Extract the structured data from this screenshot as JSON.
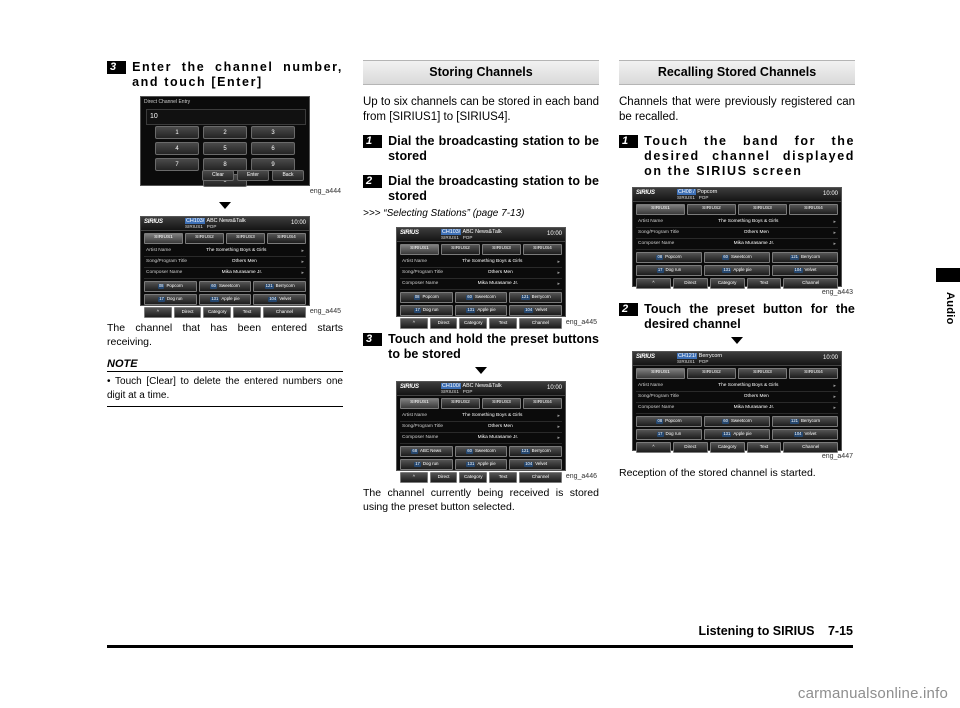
{
  "footer": {
    "title": "Listening to SIRIUS",
    "page": "7-15"
  },
  "sidetab": {
    "label": "Audio"
  },
  "watermark": "carmanualsonline.info",
  "col1": {
    "step3": {
      "num": "3",
      "text": "Enter the channel number, and touch [Enter]"
    },
    "caption1": "eng_a444",
    "caption2": "eng_a445",
    "body": "The channel that has been entered starts receiving.",
    "note_title": "NOTE",
    "note_item": "• Touch [Clear] to delete the entered numbers one digit at a time."
  },
  "col2": {
    "section_title": "Storing Channels",
    "intro": "Up to six channels can be stored in each band from [SIRIUS1] to [SIRIUS4].",
    "step1": {
      "num": "1",
      "text": "Dial the broadcasting station to be stored"
    },
    "step2": {
      "num": "2",
      "text": "Dial the broadcasting station to be stored"
    },
    "xref": ">>> “Selecting Stations” (page 7-13)",
    "caption1": "eng_a445",
    "step3": {
      "num": "3",
      "text": "Touch and hold the preset buttons to be stored"
    },
    "caption2": "eng_a446",
    "body": "The channel currently being received is stored using the preset button selected."
  },
  "col3": {
    "section_title": "Recalling Stored Channels",
    "intro": "Channels that were previously registered can be recalled.",
    "step1": {
      "num": "1",
      "text": "Touch the band for the desired channel displayed on the SIRIUS screen"
    },
    "caption1": "eng_a443",
    "step2": {
      "num": "2",
      "text": "Touch the preset button for the desired channel"
    },
    "caption2": "eng_a447",
    "body": "Reception of the stored channel is started."
  },
  "dialpad": {
    "title": "Direct Channel Entry",
    "value": "10",
    "keys": [
      [
        "1",
        "2",
        "3"
      ],
      [
        "4",
        "5",
        "6"
      ],
      [
        "7",
        "8",
        "9"
      ],
      [
        "",
        "0",
        ""
      ]
    ],
    "center_key": "0",
    "buttons": [
      "Clear",
      "Enter",
      "Back"
    ],
    "back_icon": "back-arrow-icon"
  },
  "sirius_a445": {
    "logo": "SIRIUS",
    "channel": "CH103/",
    "station": "ABC News&Talk",
    "band": "SIRIUS1",
    "category": "POP",
    "clock": "10:00",
    "presets": [
      "SIRIUS1",
      "SIRIUS2",
      "SIRIUS3",
      "SIRIUS4"
    ],
    "rows": [
      {
        "label": "Artist Name",
        "value": "The Something Boys & Girls"
      },
      {
        "label": "Song/Program Title",
        "value": "Others Men"
      },
      {
        "label": "Composer Name",
        "value": "Mika Murasame Jr."
      }
    ],
    "mid": [
      {
        "num": "08",
        "label": "Popcorn"
      },
      {
        "num": "60",
        "label": "Sweetcorn"
      },
      {
        "num": "121",
        "label": "Berrycorn"
      }
    ],
    "mid2": [
      {
        "num": "17",
        "label": "Dog run"
      },
      {
        "num": "131",
        "label": "Apple pie"
      },
      {
        "num": "104",
        "label": "Velvet"
      }
    ],
    "bottom": [
      "^",
      "Direct",
      "Category",
      "Text",
      "Channel"
    ],
    "channel_left_icon": "left-arrow-icon",
    "channel_right_icon": "right-arrow-icon"
  },
  "sirius_a446": {
    "logo": "SIRIUS",
    "channel": "CH100/",
    "station": "ABC News&Talk",
    "band": "SIRIUS1",
    "category": "POP",
    "clock": "10:00",
    "presets": [
      "SIRIUS1",
      "SIRIUS2",
      "SIRIUS3",
      "SIRIUS4"
    ],
    "rows": [
      {
        "label": "Artist Name",
        "value": "The Something Boys & Girls"
      },
      {
        "label": "Song/Program Title",
        "value": "Others Men"
      },
      {
        "label": "Composer Name",
        "value": "Mika Murasame Jr."
      }
    ],
    "mid": [
      {
        "num": "68",
        "label": "ABC News"
      },
      {
        "num": "60",
        "label": "Sweetcorn"
      },
      {
        "num": "121",
        "label": "Berrycorn"
      }
    ],
    "mid2": [
      {
        "num": "17",
        "label": "Dog run"
      },
      {
        "num": "131",
        "label": "Apple pie"
      },
      {
        "num": "104",
        "label": "Velvet"
      }
    ],
    "bottom": [
      "^",
      "Direct",
      "Category",
      "Text",
      "Channel"
    ]
  },
  "sirius_a443": {
    "logo": "SIRIUS",
    "channel": "CH08 /",
    "station": "Popcorn",
    "band": "SIRIUS1",
    "category": "POP",
    "clock": "10:00",
    "presets": [
      "SIRIUS1",
      "SIRIUS2",
      "SIRIUS3",
      "SIRIUS4"
    ],
    "rows": [
      {
        "label": "Artist Name",
        "value": "The Something Boys & Girls"
      },
      {
        "label": "Song/Program Title",
        "value": "Others Men"
      },
      {
        "label": "Composer Name",
        "value": "Mika Murasame Jr."
      }
    ],
    "mid": [
      {
        "num": "08",
        "label": "Popcorn"
      },
      {
        "num": "60",
        "label": "Sweetcorn"
      },
      {
        "num": "121",
        "label": "Berrycorn"
      }
    ],
    "mid2": [
      {
        "num": "17",
        "label": "Dog run"
      },
      {
        "num": "131",
        "label": "Apple pie"
      },
      {
        "num": "104",
        "label": "Velvet"
      }
    ],
    "bottom": [
      "^",
      "Direct",
      "Category",
      "Text",
      "Channel"
    ]
  },
  "sirius_a447": {
    "logo": "SIRIUS",
    "channel": "CH121/",
    "station": "Berrycorn",
    "band": "SIRIUS1",
    "category": "POP",
    "clock": "10:00",
    "presets": [
      "SIRIUS1",
      "SIRIUS2",
      "SIRIUS3",
      "SIRIUS4"
    ],
    "rows": [
      {
        "label": "Artist Name",
        "value": "The Something Boys & Girls"
      },
      {
        "label": "Song/Program Title",
        "value": "Others Men"
      },
      {
        "label": "Composer Name",
        "value": "Mika Murasame Jr."
      }
    ],
    "mid": [
      {
        "num": "08",
        "label": "Popcorn"
      },
      {
        "num": "60",
        "label": "Sweetcorn"
      },
      {
        "num": "121",
        "label": "Berrycorn"
      }
    ],
    "mid2": [
      {
        "num": "17",
        "label": "Dog run"
      },
      {
        "num": "131",
        "label": "Apple pie"
      },
      {
        "num": "104",
        "label": "Velvet"
      }
    ],
    "bottom": [
      "^",
      "Direct",
      "Category",
      "Text",
      "Channel"
    ]
  }
}
